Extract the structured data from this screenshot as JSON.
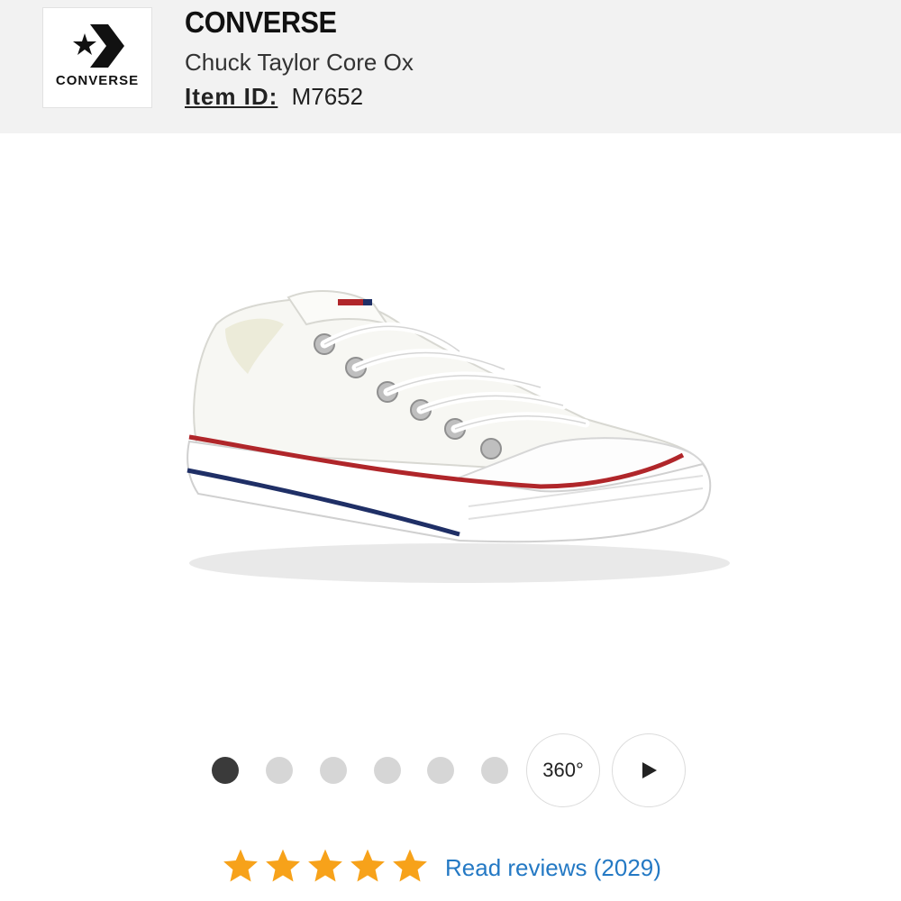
{
  "header": {
    "logo_text": "CONVERSE",
    "brand": "CONVERSE",
    "product_name": "Chuck Taylor Core Ox",
    "item_id_label": "Item ID:",
    "item_id": "M7652"
  },
  "gallery": {
    "image": "white low-top canvas sneaker",
    "dot_count": 6,
    "active_index": 0,
    "view_360_label": "360°",
    "play_icon": "play-icon"
  },
  "rating": {
    "stars": 5,
    "star_color": "#f7a21a",
    "reviews_label": "Read reviews (2029)"
  },
  "colors": {
    "header_bg": "#f2f2f2",
    "link": "#2479c4",
    "stripe_red": "#b0262a",
    "stripe_blue": "#1f2f66"
  }
}
